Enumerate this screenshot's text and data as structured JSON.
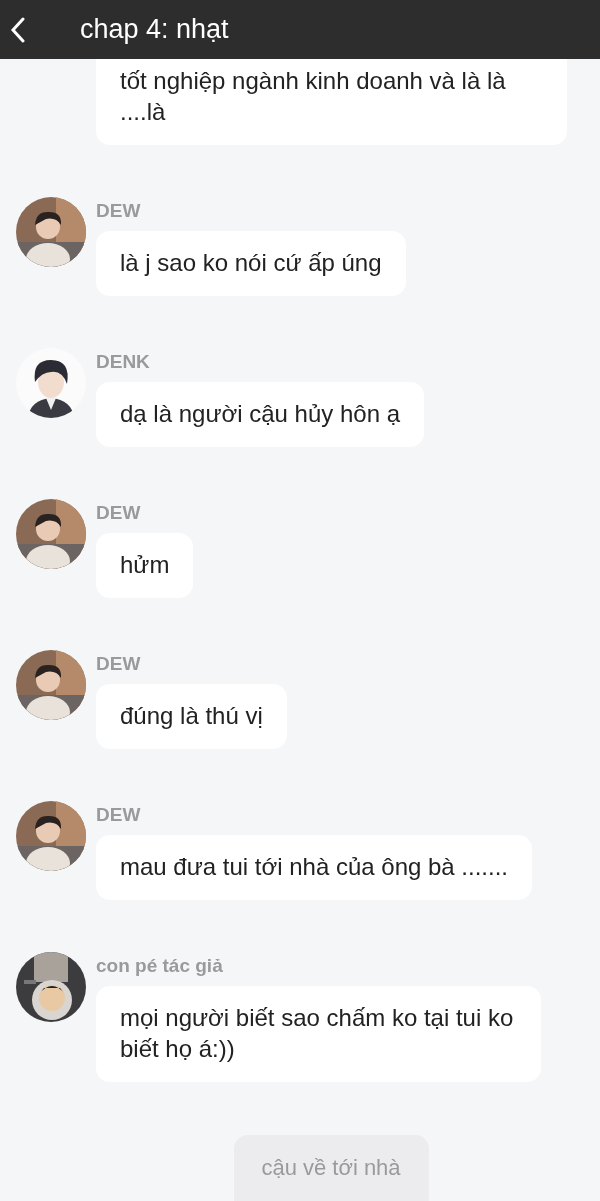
{
  "header": {
    "title": "chap 4: nhạt"
  },
  "messages": [
    {
      "text": "tốt nghiệp ngành kinh doanh và là là ....là",
      "kind": "partial"
    },
    {
      "sender": "DEW",
      "text": "là j sao ko nói cứ ấp úng"
    },
    {
      "sender": "DENK",
      "text": "dạ là người cậu hủy hôn ạ"
    },
    {
      "sender": "DEW",
      "text": "hửm"
    },
    {
      "sender": "DEW",
      "text": "đúng là thú vị"
    },
    {
      "sender": "DEW",
      "text": "mau đưa tui tới nhà của ông bà ......."
    },
    {
      "sender": "con pé tác giả",
      "text": "mọi người biết sao chấm ko tại tui ko biết họ á:))"
    }
  ],
  "next_button": {
    "label": "cậu về tới nhà"
  }
}
